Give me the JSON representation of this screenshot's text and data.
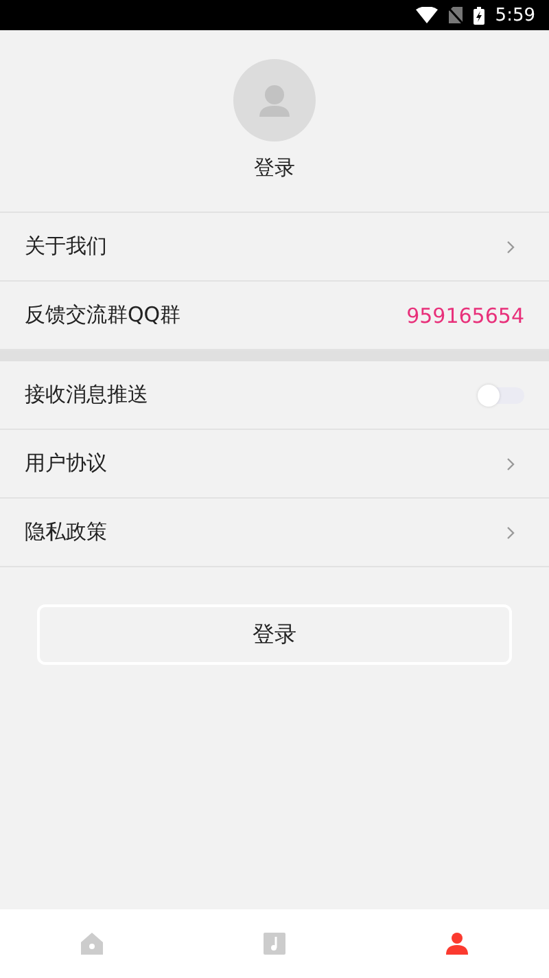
{
  "status_bar": {
    "time": "5:59"
  },
  "profile": {
    "name": "登录"
  },
  "groups": [
    {
      "items": [
        {
          "kind": "link",
          "label": "关于我们"
        },
        {
          "kind": "value",
          "label": "反馈交流群QQ群",
          "value": "959165654"
        }
      ]
    },
    {
      "items": [
        {
          "kind": "toggle",
          "label": "接收消息推送",
          "on": false
        },
        {
          "kind": "link",
          "label": "用户协议"
        },
        {
          "kind": "link",
          "label": "隐私政策"
        }
      ]
    }
  ],
  "login_button": "登录",
  "tabs": [
    {
      "kind": "home",
      "selected": false
    },
    {
      "kind": "music",
      "selected": false
    },
    {
      "kind": "user",
      "selected": true
    }
  ]
}
